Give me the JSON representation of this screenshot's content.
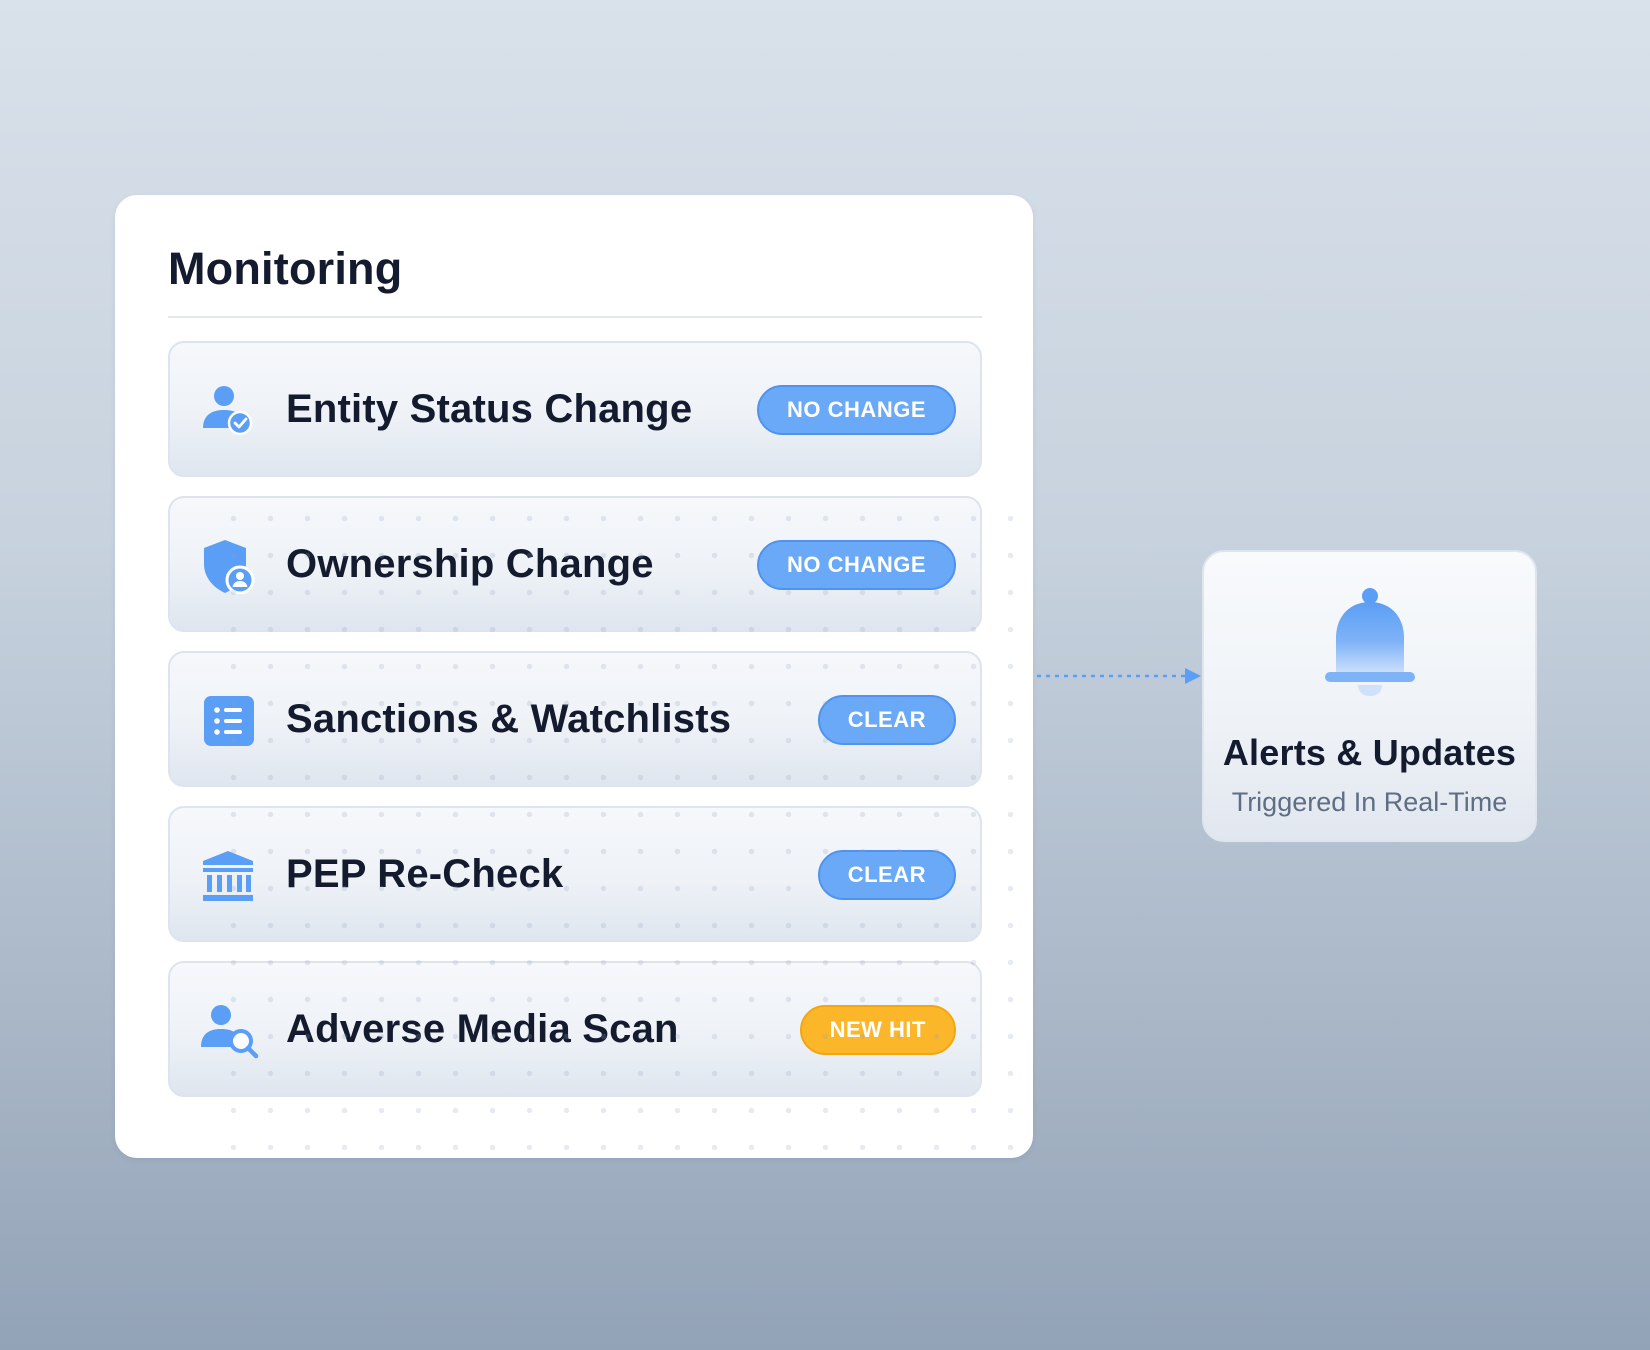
{
  "panel": {
    "title": "Monitoring",
    "rows": [
      {
        "label": "Entity Status Change",
        "icon": "user-check-icon",
        "badge": "NO CHANGE",
        "badge_color": "#6aa9f7"
      },
      {
        "label": "Ownership Change",
        "icon": "shield-user-icon",
        "badge": "NO CHANGE",
        "badge_color": "#6aa9f7"
      },
      {
        "label": "Sanctions & Watchlists",
        "icon": "list-icon",
        "badge": "CLEAR",
        "badge_color": "#6aa9f7"
      },
      {
        "label": "PEP Re-Check",
        "icon": "bank-icon",
        "badge": "CLEAR",
        "badge_color": "#6aa9f7"
      },
      {
        "label": "Adverse Media Scan",
        "icon": "user-search-icon",
        "badge": "NEW HIT",
        "badge_color": "#fbb62a"
      }
    ]
  },
  "alert": {
    "icon": "bell-icon",
    "title": "Alerts & Updates",
    "subtitle": "Triggered In Real-Time"
  },
  "colors": {
    "accent": "#5b9ef5",
    "text": "#141b2e",
    "muted": "#5f6e85",
    "amber": "#fbb62a"
  }
}
